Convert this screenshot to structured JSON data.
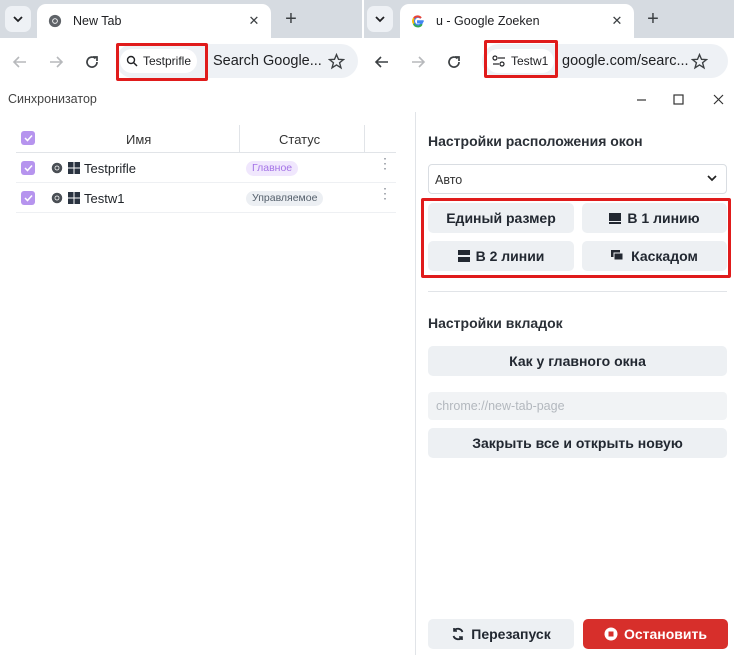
{
  "browser_left": {
    "tab_title": "New Tab",
    "chip_label": "Testprifle",
    "omnibox_text": "Search Google..."
  },
  "browser_right": {
    "tab_title": "u - Google Zoeken",
    "chip_label": "Testw1",
    "omnibox_text": "google.com/searc..."
  },
  "window": {
    "title": "Синхронизатор"
  },
  "table": {
    "columns": [
      "Имя",
      "Статус"
    ],
    "rows": [
      {
        "name": "Testprifle",
        "status": "Главное",
        "checked": true
      },
      {
        "name": "Testw1",
        "status": "Управляемое",
        "checked": true
      }
    ]
  },
  "layout_settings": {
    "title": "Настройки расположения окон",
    "mode_select": "Авто",
    "uniform_size_label": "Единый размер",
    "one_line_label": "В 1 линию",
    "two_lines_label": "В 2 линии",
    "cascade_label": "Каскадом"
  },
  "tab_settings": {
    "title": "Настройки вкладок",
    "like_main_label": "Как у главного окна",
    "url_placeholder": "chrome://new-tab-page",
    "close_all_label": "Закрыть все и открыть новую"
  },
  "footer": {
    "restart_label": "Перезапуск",
    "stop_label": "Остановить"
  },
  "colors": {
    "accent_purple": "#b694ee",
    "stop_red": "#d72f2b",
    "highlight_red": "#e01b1b"
  }
}
